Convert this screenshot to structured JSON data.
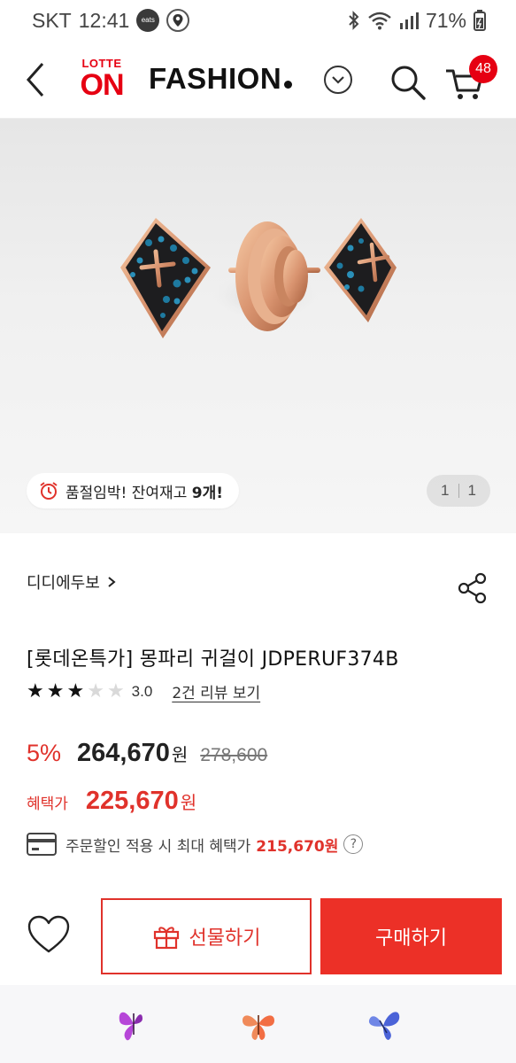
{
  "status_bar": {
    "carrier": "SKT",
    "time": "12:41",
    "battery": "71%",
    "app_icons": [
      "coupang-eats-icon",
      "map-pin-icon"
    ]
  },
  "header": {
    "logo_top": "LOTTE",
    "logo_main": "ON",
    "title": "FASHION",
    "cart_count": "48"
  },
  "hero": {
    "stock_text_prefix": "품절임박! 잔여재고 ",
    "stock_count": "9개!",
    "image_index": "1",
    "image_total": "1"
  },
  "product": {
    "brand": "디디에두보",
    "title": "[롯데온특가] 몽파리 귀걸이 JDPERUF374B",
    "rating": 3.0,
    "rating_text": "3.0",
    "review_text": "2건 리뷰 보기",
    "discount": "5%",
    "price": "264,670",
    "currency": "원",
    "original_price": "278,600",
    "benefit_label": "혜택가",
    "benefit_price": "225,670",
    "card_text": "주문할인 적용 시 최대 혜택가",
    "card_max_price": "215,670원"
  },
  "actions": {
    "gift_label": "선물하기",
    "buy_label": "구매하기"
  },
  "colors": {
    "brand_red": "#e60012",
    "sale_red": "#e0322b",
    "buy_red": "#ec3027"
  },
  "bottom_icons": [
    "purple-butterfly-icon",
    "orange-butterfly-icon",
    "blue-butterfly-icon"
  ]
}
